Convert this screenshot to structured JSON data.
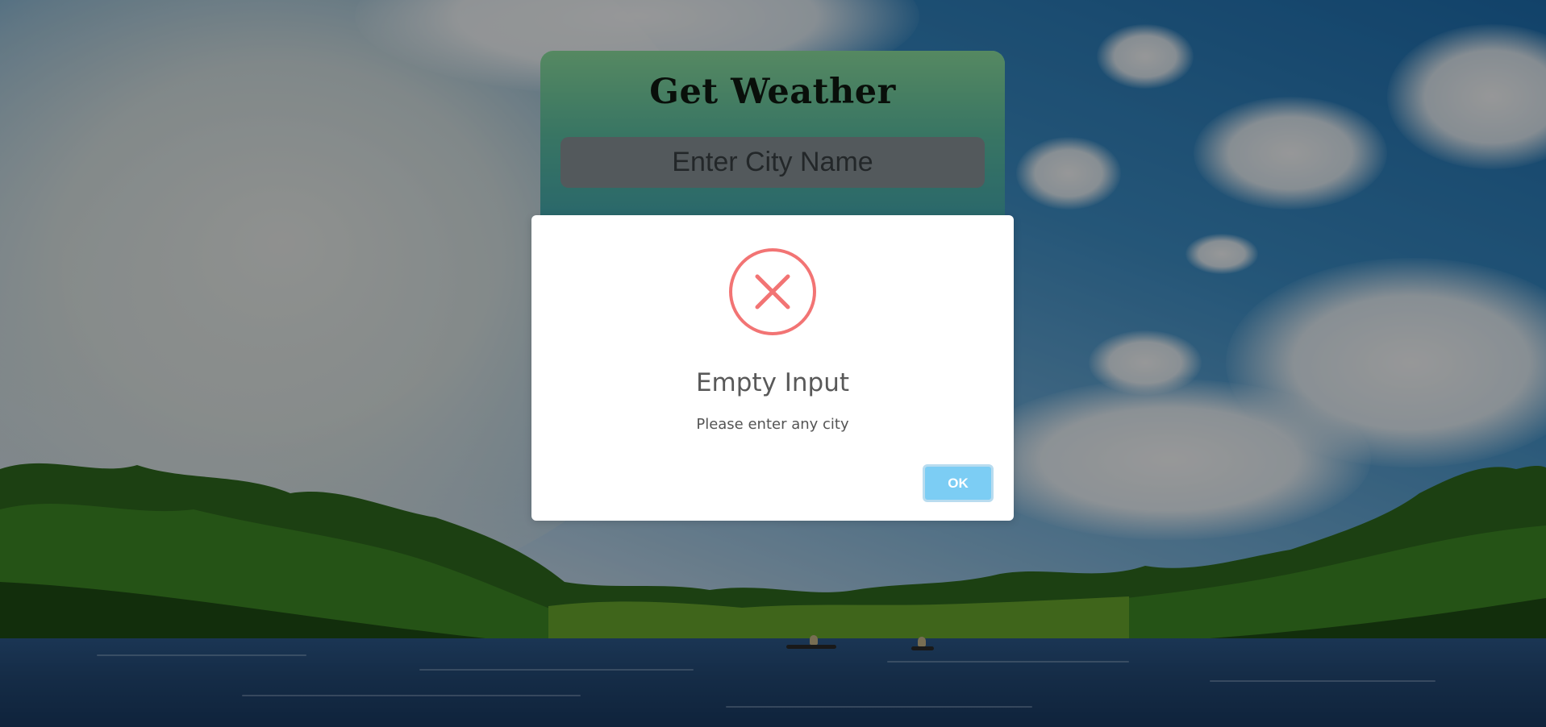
{
  "weather_card": {
    "title": "Get Weather",
    "city_input_placeholder": "Enter City Name",
    "city_input_value": ""
  },
  "alert": {
    "icon": "error-x-circle-icon",
    "title": "Empty Input",
    "text": "Please enter any city",
    "ok_label": "OK"
  },
  "colors": {
    "error_icon": "#f27474",
    "ok_button": "#7ccdf4",
    "card_gradient_top": "#8fe4a2",
    "card_gradient_bottom": "#41a8b5"
  }
}
